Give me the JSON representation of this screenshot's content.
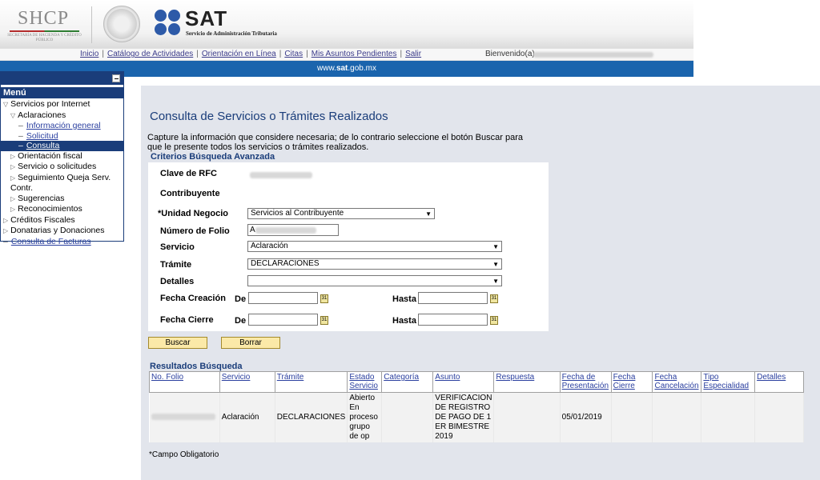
{
  "header": {
    "shcp_logo": "SHCP",
    "shcp_subtitle": "SECRETARÍA DE HACIENDA Y CRÉDITO PÚBLICO",
    "sat_logo": "SAT",
    "sat_subtitle": "Servicio de Administración Tributaria"
  },
  "topnav": {
    "links": [
      "Inicio",
      "Catálogo de Actividades",
      "Orientación en Línea",
      "Citas",
      "Mis Asuntos Pendientes",
      "Salir"
    ],
    "welcome": "Bienvenido(a)"
  },
  "bluebar": {
    "prefix": "www.",
    "domain": "sat",
    "suffix": ".gob.mx"
  },
  "sidebar": {
    "title": "Menú",
    "items": [
      {
        "label": "Servicios por Internet"
      },
      {
        "label": "Aclaraciones"
      },
      {
        "label": "Información general"
      },
      {
        "label": "Solicitud"
      },
      {
        "label": "Consulta"
      },
      {
        "label": "Orientación fiscal"
      },
      {
        "label": "Servicio o solicitudes"
      },
      {
        "label": "Seguimiento Queja Serv. Contr."
      },
      {
        "label": "Sugerencias"
      },
      {
        "label": "Reconocimientos"
      },
      {
        "label": "Créditos Fiscales"
      },
      {
        "label": "Donatarias y Donaciones"
      },
      {
        "label": "Consulta de Facturas"
      }
    ]
  },
  "main": {
    "title": "Consulta de Servicios o Trámites Realizados",
    "intro": "Capture la información que considere necesaria; de lo contrario seleccione el botón Buscar para que le presente todos los servicios o trámites realizados.",
    "criteria_title": "Criterios Búsqueda Avanzada",
    "labels": {
      "rfc": "Clave de RFC",
      "contribuyente": "Contribuyente",
      "unidad_negocio": "*Unidad Negocio",
      "numero_folio": "Número de Folio",
      "servicio": "Servicio",
      "tramite": "Trámite",
      "detalles": "Detalles",
      "fecha_creacion": "Fecha Creación",
      "fecha_cierre": "Fecha Cierre",
      "de": "De",
      "hasta": "Hasta"
    },
    "values": {
      "unidad_negocio": "Servicios al Contribuyente",
      "numero_folio": "A",
      "servicio": "Aclaración",
      "tramite": "DECLARACIONES",
      "detalles": ""
    },
    "buttons": {
      "buscar": "Buscar",
      "borrar": "Borrar"
    },
    "results_title": "Resultados Búsqueda",
    "columns": [
      "No. Folio",
      "Servicio",
      "Trámite",
      "Estado Servicio",
      "Categoría",
      "Asunto",
      "Respuesta",
      "Fecha de Presentación",
      "Fecha Cierre",
      "Fecha Cancelación",
      "Tipo Especialidad",
      "Detalles"
    ],
    "rows": [
      {
        "servicio": "Aclaración",
        "tramite": "DECLARACIONES",
        "estado": "Abierto En proceso grupo de op",
        "categoria": "",
        "asunto": "VERIFICACION DE REGISTRO DE PAGO DE 1 ER BIMESTRE 2019",
        "respuesta": "",
        "fecha_presentacion": "05/01/2019",
        "fecha_cierre": "",
        "fecha_cancelacion": "",
        "tipo_especialidad": "",
        "detalles": ""
      }
    ],
    "footnote": "*Campo Obligatorio"
  }
}
